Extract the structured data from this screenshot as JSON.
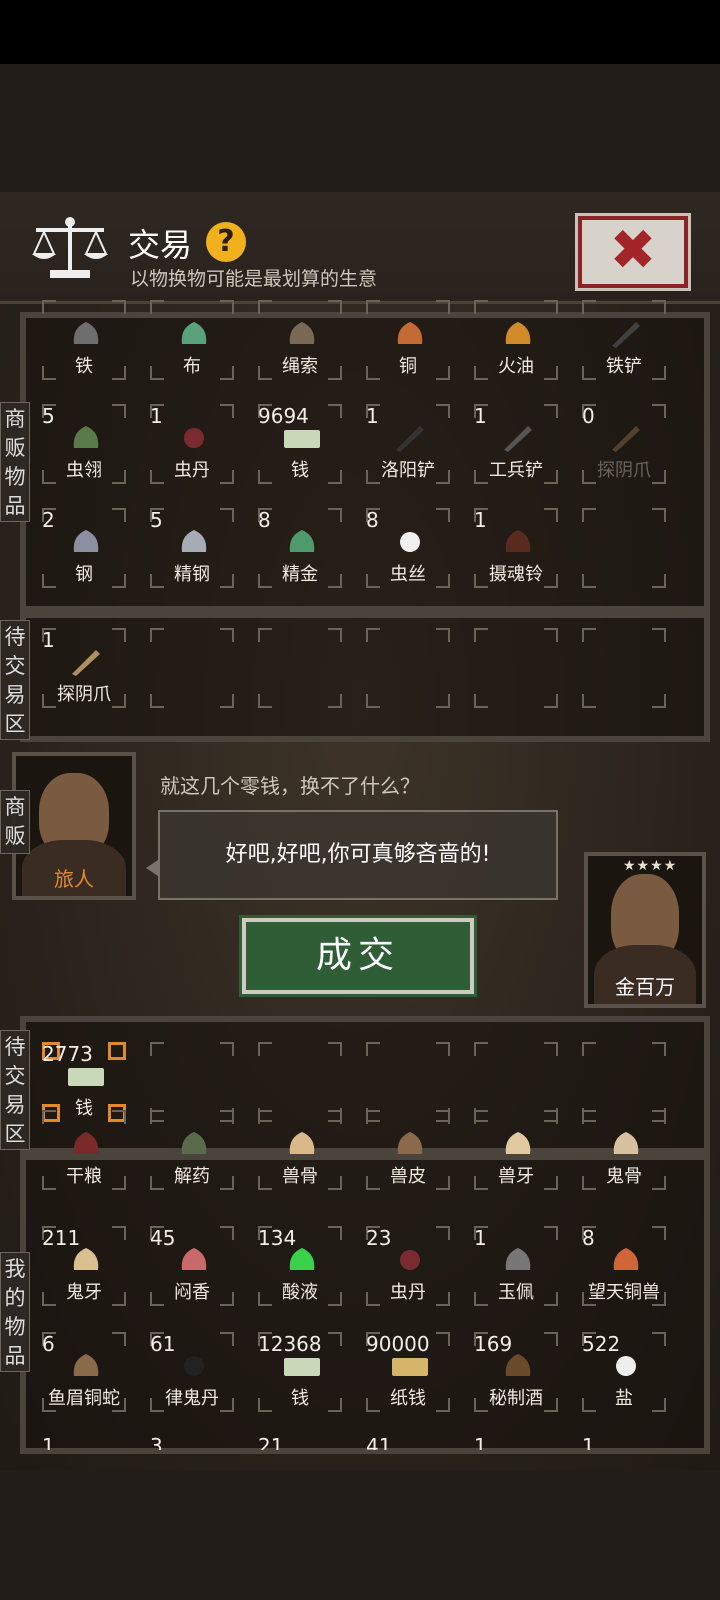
{
  "header": {
    "title": "交易",
    "help_glyph": "?",
    "subtitle": "以物换物可能是最划算的生意",
    "close_glyph": "✖"
  },
  "labels": {
    "merchant_goods": "商贩物品",
    "pending_trade": "待交易区",
    "merchant": "商贩",
    "my_goods": "我的物品"
  },
  "merchant_goods": [
    {
      "name": "铁",
      "count": "",
      "icon": "iron-icon"
    },
    {
      "name": "布",
      "count": "",
      "icon": "cloth-icon"
    },
    {
      "name": "绳索",
      "count": "",
      "icon": "rope-icon"
    },
    {
      "name": "铜",
      "count": "",
      "icon": "copper-icon"
    },
    {
      "name": "火油",
      "count": "",
      "icon": "fire-oil-icon"
    },
    {
      "name": "铁铲",
      "count": "",
      "icon": "iron-shovel-icon"
    },
    {
      "name": "虫翎",
      "count": "5",
      "icon": "insect-feather-icon"
    },
    {
      "name": "虫丹",
      "count": "1",
      "icon": "insect-pill-icon"
    },
    {
      "name": "钱",
      "count": "9694",
      "icon": "money-icon"
    },
    {
      "name": "洛阳铲",
      "count": "1",
      "icon": "luoyang-shovel-icon"
    },
    {
      "name": "工兵铲",
      "count": "1",
      "icon": "sapper-shovel-icon"
    },
    {
      "name": "探阴爪",
      "count": "0",
      "icon": "grabber-icon"
    },
    {
      "name": "钢",
      "count": "2",
      "icon": "steel-icon"
    },
    {
      "name": "精钢",
      "count": "5",
      "icon": "fine-steel-icon"
    },
    {
      "name": "精金",
      "count": "8",
      "icon": "fine-gold-icon"
    },
    {
      "name": "虫丝",
      "count": "8",
      "icon": "silk-icon"
    },
    {
      "name": "摄魂铃",
      "count": "1",
      "icon": "soul-bell-icon"
    }
  ],
  "merchant_pending": [
    {
      "name": "探阴爪",
      "count": "1",
      "icon": "grabber-icon"
    }
  ],
  "merchant": {
    "name": "旅人",
    "dialog_line": "就这几个零钱，换不了什么？",
    "bubble_text": "好吧,好吧,你可真够吝啬的!"
  },
  "deal_button": "成交",
  "player": {
    "name": "金百万",
    "stars": "★★★★"
  },
  "my_pending": [
    {
      "name": "钱",
      "count": "2773",
      "icon": "money-icon"
    }
  ],
  "my_goods": [
    {
      "name": "干粮",
      "count": "",
      "icon": "dry-food-icon"
    },
    {
      "name": "解药",
      "count": "",
      "icon": "antidote-icon"
    },
    {
      "name": "兽骨",
      "count": "",
      "icon": "beast-bone-icon"
    },
    {
      "name": "兽皮",
      "count": "",
      "icon": "beast-hide-icon"
    },
    {
      "name": "兽牙",
      "count": "",
      "icon": "beast-tooth-icon"
    },
    {
      "name": "鬼骨",
      "count": "",
      "icon": "ghost-bone-icon"
    },
    {
      "name": "鬼牙",
      "count": "211",
      "icon": "ghost-tooth-icon"
    },
    {
      "name": "闷香",
      "count": "45",
      "icon": "incense-icon"
    },
    {
      "name": "酸液",
      "count": "134",
      "icon": "acid-icon"
    },
    {
      "name": "虫丹",
      "count": "23",
      "icon": "insect-pill-icon"
    },
    {
      "name": "玉佩",
      "count": "1",
      "icon": "jade-icon"
    },
    {
      "name": "望天铜兽",
      "count": "8",
      "icon": "bronze-beast-icon"
    },
    {
      "name": "鱼眉铜蛇",
      "count": "6",
      "icon": "bronze-snake-icon"
    },
    {
      "name": "律鬼丹",
      "count": "61",
      "icon": "ghost-pill-icon"
    },
    {
      "name": "钱",
      "count": "12368",
      "icon": "money-icon"
    },
    {
      "name": "纸钱",
      "count": "90000",
      "icon": "paper-money-icon"
    },
    {
      "name": "秘制酒",
      "count": "169",
      "icon": "wine-icon"
    },
    {
      "name": "盐",
      "count": "522",
      "icon": "salt-icon"
    }
  ],
  "my_goods_partial_counts": [
    "1",
    "3",
    "21",
    "41",
    "1",
    "1"
  ],
  "colors": {
    "accent_orange": "#e08a2c",
    "deal_green": "#2f5e36",
    "close_red": "#a3252a",
    "help_yellow": "#f0b11d"
  }
}
